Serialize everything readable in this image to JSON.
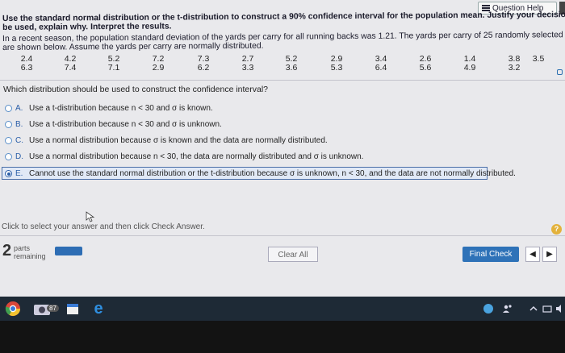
{
  "header": {
    "help_label": "Question Help"
  },
  "problem": {
    "instructions_line1": "Use the standard normal distribution or the t-distribution to construct a 90% confidence interval for the population mean. Justify your decision. If neither distribution can",
    "instructions_line2": "be used, explain why. Interpret the results.",
    "context_line1": "In a recent season, the population standard deviation of the yards per carry for all running backs was 1.21. The yards per carry of 25 randomly selected running backs",
    "context_line2": "are shown below. Assume the yards per carry are normally distributed.",
    "data_rows": [
      [
        "2.4",
        "4.2",
        "5.2",
        "7.2",
        "7.3",
        "2.7",
        "5.2",
        "2.9",
        "3.4",
        "2.6",
        "1.4",
        "3.8",
        "3.5"
      ],
      [
        "6.3",
        "7.4",
        "7.1",
        "2.9",
        "6.2",
        "3.3",
        "3.6",
        "5.3",
        "6.4",
        "5.6",
        "4.9",
        "3.2"
      ]
    ],
    "question": "Which distribution should be used to construct the confidence interval?"
  },
  "options": [
    {
      "letter": "A.",
      "text": "Use a t-distribution because n < 30 and σ is known.",
      "selected": false
    },
    {
      "letter": "B.",
      "text": "Use a t-distribution because n < 30 and σ is unknown.",
      "selected": false
    },
    {
      "letter": "C.",
      "text": "Use a normal distribution because σ is known and the data are normally distributed.",
      "selected": false
    },
    {
      "letter": "D.",
      "text": "Use a normal distribution because n < 30, the data are normally distributed and σ is unknown.",
      "selected": false
    },
    {
      "letter": "E.",
      "text": "Cannot use the standard normal distribution or the t-distribution because σ is unknown, n < 30, and the data are not normally distributed.",
      "selected": true
    }
  ],
  "footer": {
    "click_prompt": "Click to select your answer and then click Check Answer.",
    "parts_count": "2",
    "parts_label_line1": "parts",
    "parts_label_line2": "remaining",
    "clear_label": "Clear All",
    "final_label": "Final Check",
    "prev_glyph": "◀",
    "next_glyph": "▶",
    "help_glyph": "?"
  },
  "taskbar": {
    "badge": "87",
    "browser_glyph": "e"
  },
  "colors": {
    "accent": "#2e72b8",
    "selected_bg": "#e1e9f6",
    "help_circle": "#e3b23c"
  }
}
